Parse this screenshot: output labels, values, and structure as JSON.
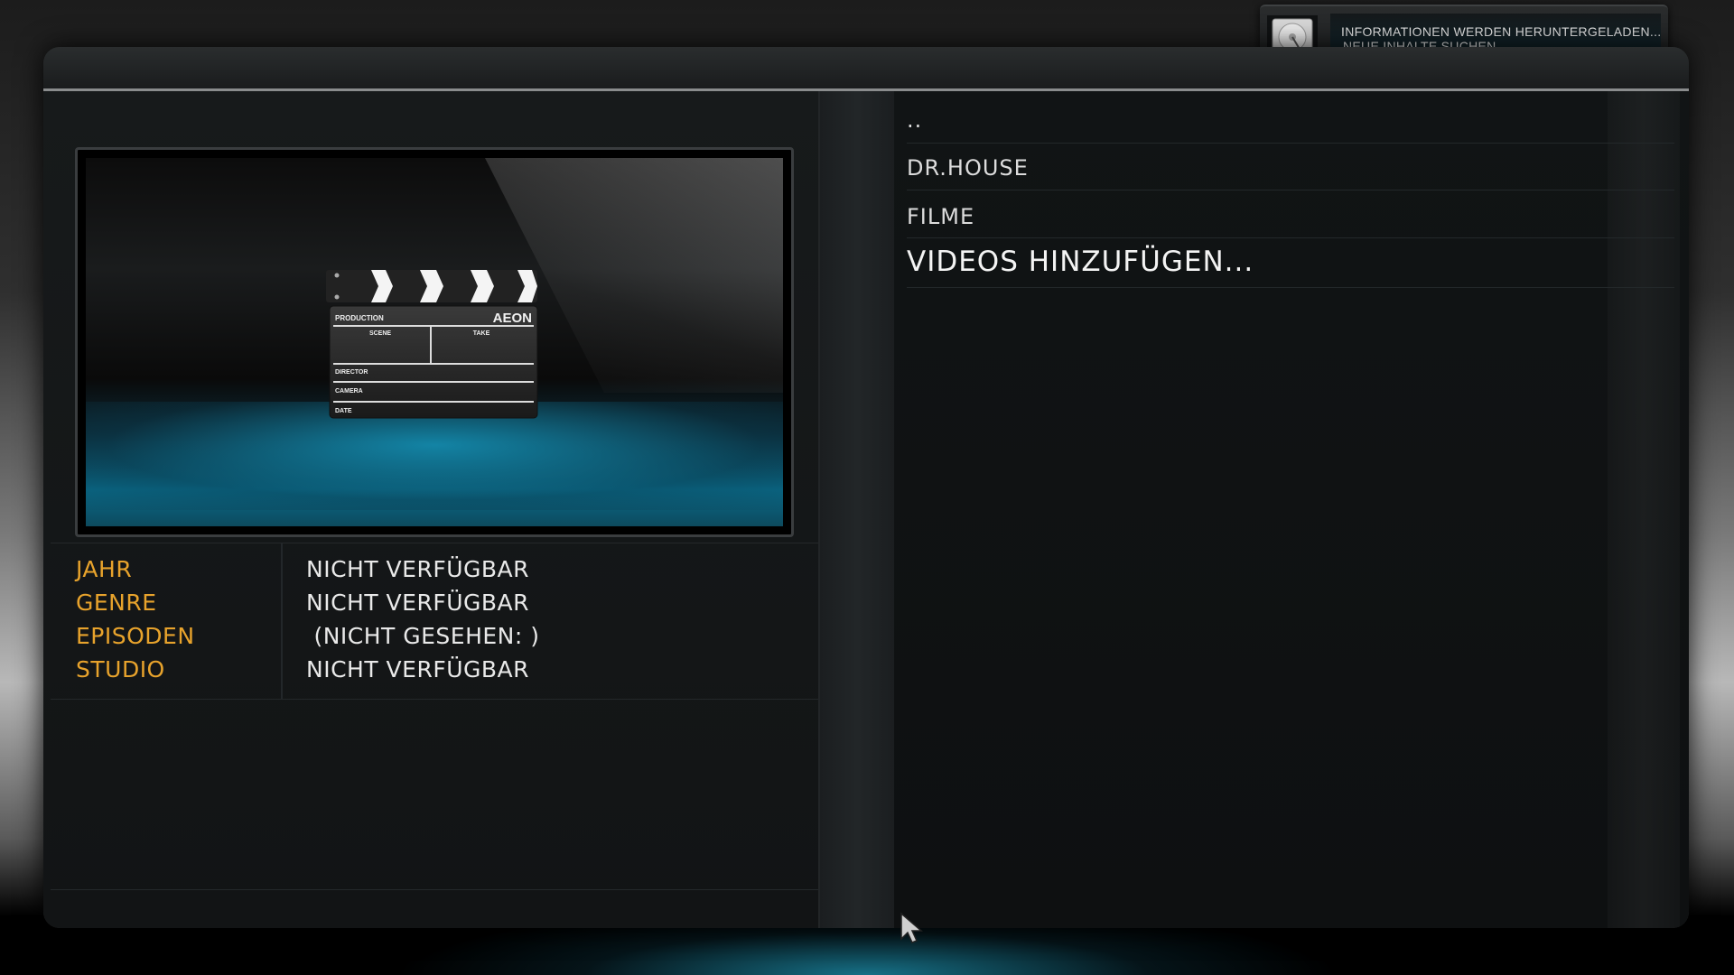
{
  "notification": {
    "icon": "hard-disk-icon",
    "line1": "INFORMATIONEN WERDEN HERUNTERGELADEN...",
    "line2": "NEUE INHALTE SUCHEN"
  },
  "thumbnail": {
    "icon": "clapperboard-icon",
    "clapper_brand": "AEON",
    "fields": [
      "PRODUCTION",
      "SCENE",
      "TAKE",
      "DIRECTOR",
      "CAMERA",
      "DATE"
    ]
  },
  "info": [
    {
      "label": "JAHR",
      "value": "NICHT VERFÜGBAR"
    },
    {
      "label": "GENRE",
      "value": "NICHT VERFÜGBAR"
    },
    {
      "label": "EPISODEN",
      "value": " (NICHT GESEHEN: )"
    },
    {
      "label": "STUDIO",
      "value": "NICHT VERFÜGBAR"
    }
  ],
  "list": {
    "items": [
      {
        "label": ".."
      },
      {
        "label": "DR.HOUSE"
      },
      {
        "label": "FILME"
      },
      {
        "label": "VIDEOS HINZUFÜGEN..."
      }
    ],
    "selected_index": 3
  },
  "colors": {
    "label_accent": "#e8a32c",
    "glow": "#1e96b4"
  }
}
